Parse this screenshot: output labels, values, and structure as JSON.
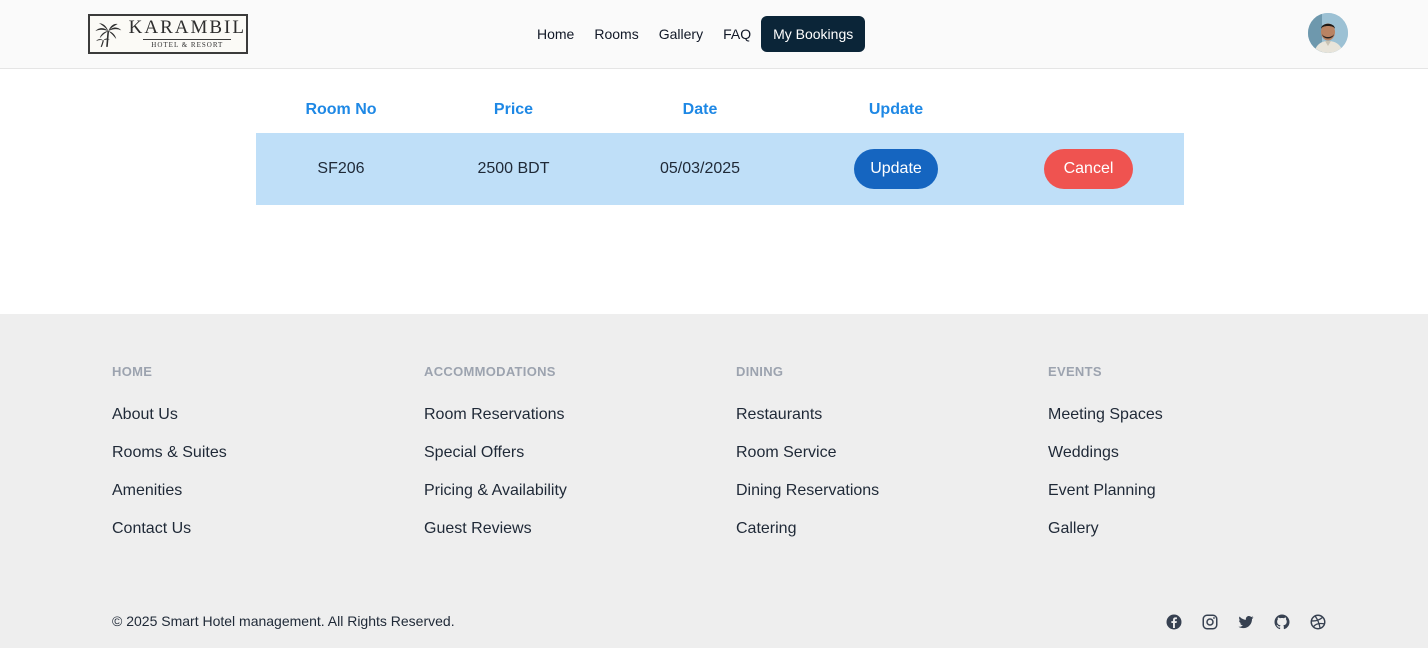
{
  "brand": {
    "name": "KARAMBIL",
    "subtitle": "HOTEL & RESORT"
  },
  "nav": {
    "items": [
      "Home",
      "Rooms",
      "Gallery",
      "FAQ",
      "My Bookings"
    ],
    "active": "My Bookings"
  },
  "bookings": {
    "headers": [
      "Room No",
      "Price",
      "Date",
      "Update"
    ],
    "rows": [
      {
        "room_no": "SF206",
        "price": "2500 BDT",
        "date": "05/03/2025",
        "update_label": "Update",
        "cancel_label": "Cancel"
      }
    ]
  },
  "footer": {
    "columns": [
      {
        "heading": "HOME",
        "links": [
          "About Us",
          "Rooms & Suites",
          "Amenities",
          "Contact Us"
        ]
      },
      {
        "heading": "ACCOMMODATIONS",
        "links": [
          "Room Reservations",
          "Special Offers",
          "Pricing & Availability",
          "Guest Reviews"
        ]
      },
      {
        "heading": "DINING",
        "links": [
          "Restaurants",
          "Room Service",
          "Dining Reservations",
          "Catering"
        ]
      },
      {
        "heading": "EVENTS",
        "links": [
          "Meeting Spaces",
          "Weddings",
          "Event Planning",
          "Gallery"
        ]
      }
    ],
    "copyright": "© 2025 Smart Hotel management. All Rights Reserved.",
    "socials": [
      "facebook-icon",
      "instagram-icon",
      "twitter-icon",
      "github-icon",
      "dribbble-icon"
    ]
  },
  "colors": {
    "accent": "#1e88e5",
    "update_button": "#1565c0",
    "cancel_button": "#ef5350",
    "nav_active": "#0b2538",
    "row_highlight": "#bfdff8",
    "footer_bg": "#eeeeee"
  }
}
